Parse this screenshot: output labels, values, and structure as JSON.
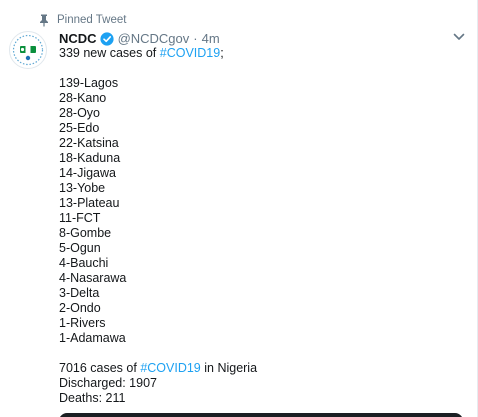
{
  "pinned": {
    "label": "Pinned Tweet"
  },
  "author": {
    "name": "NCDC",
    "handle": "@NCDCgov",
    "separator": "·",
    "time": "4m"
  },
  "tweet": {
    "intro": {
      "pre": "339 new cases of ",
      "hashtag": "#COVID19",
      "post": ";"
    },
    "cases": [
      "139-Lagos",
      "28-Kano",
      "28-Oyo",
      "25-Edo",
      "22-Katsina",
      "18-Kaduna",
      "14-Jigawa",
      "13-Yobe",
      "13-Plateau",
      "11-FCT",
      "8-Gombe",
      "5-Ogun",
      "4-Bauchi",
      "4-Nasarawa",
      "3-Delta",
      "2-Ondo",
      "1-Rivers",
      "1-Adamawa"
    ],
    "summary": {
      "pre": "7016 cases of ",
      "hashtag": "#COVID19",
      "post": " in Nigeria"
    },
    "discharged": "Discharged: 1907",
    "deaths": "Deaths: 211"
  },
  "colors": {
    "accent": "#1da1f2",
    "secondary_text": "#657786",
    "avatar_green": "#0a8f3c"
  },
  "icons": {
    "pin": "pin-icon",
    "verified": "verified-badge-icon",
    "caret": "chevron-down-icon"
  }
}
